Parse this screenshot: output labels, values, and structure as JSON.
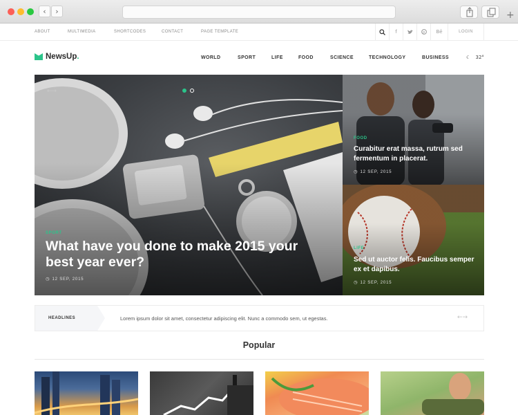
{
  "browser": {
    "back_glyph": "‹",
    "forward_glyph": "›",
    "new_tab_glyph": "+"
  },
  "topbar": {
    "links": [
      "ABOUT",
      "MULTIMEDIA",
      "SHORTCODES",
      "CONTACT",
      "PAGE TEMPLATE"
    ],
    "social_icons": [
      "search-icon",
      "facebook-icon",
      "twitter-icon",
      "pinterest-icon",
      "behance-icon"
    ],
    "behance_label": "Bē",
    "login_label": "LOGIN"
  },
  "header": {
    "logo_name": "NewsUp",
    "logo_dot": ".",
    "nav": [
      "WORLD",
      "SPORT",
      "LIFE",
      "FOOD",
      "SCIENCE",
      "TECHNOLOGY",
      "BUSINESS"
    ],
    "weather": "32°"
  },
  "hero": {
    "category": "SPORT",
    "title": "What have you done to make 2015 your best year ever?",
    "date": "12 SEP, 2015"
  },
  "side_cards": [
    {
      "category": "FOOD",
      "title": "Curabitur erat massa, rutrum sed fermentum in placerat.",
      "date": "12 SEP, 2015"
    },
    {
      "category": "LIFE",
      "title": "Sed ut auctor felis. Faucibus semper ex et dapibus.",
      "date": "12 SEP, 2015"
    }
  ],
  "ticker": {
    "label": "HEADLINES",
    "text": "Lorem ipsum dolor sit amet, consectetur adipiscing elit. Nunc a commodo sem, ut egestas."
  },
  "popular": {
    "title": "Popular"
  },
  "colors": {
    "accent": "#2bc48a"
  }
}
